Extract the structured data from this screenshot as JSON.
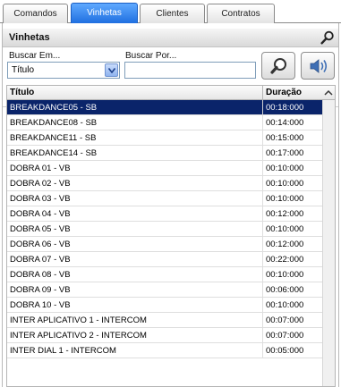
{
  "tabs": [
    {
      "label": "Comandos",
      "active": false
    },
    {
      "label": "Vinhetas",
      "active": true
    },
    {
      "label": "Clientes",
      "active": false
    },
    {
      "label": "Contratos",
      "active": false
    }
  ],
  "panel": {
    "title": "Vinhetas",
    "title_icon": "magnifier-icon"
  },
  "search": {
    "field_label": "Buscar Em...",
    "field_value": "Título",
    "query_label": "Buscar Por...",
    "query_value": "",
    "search_button_icon": "magnifier-icon",
    "audio_button_icon": "speaker-icon"
  },
  "table": {
    "columns": [
      "Título",
      "Duração"
    ],
    "selected_index": 0,
    "rows": [
      {
        "title": "BREAKDANCE05 - SB",
        "duration": "00:18:000"
      },
      {
        "title": "BREAKDANCE08 - SB",
        "duration": "00:14:000"
      },
      {
        "title": "BREAKDANCE11 - SB",
        "duration": "00:15:000"
      },
      {
        "title": "BREAKDANCE14 - SB",
        "duration": "00:17:000"
      },
      {
        "title": "DOBRA 01 - VB",
        "duration": "00:10:000"
      },
      {
        "title": "DOBRA 02 - VB",
        "duration": "00:10:000"
      },
      {
        "title": "DOBRA 03 - VB",
        "duration": "00:10:000"
      },
      {
        "title": "DOBRA 04 - VB",
        "duration": "00:12:000"
      },
      {
        "title": "DOBRA 05 - VB",
        "duration": "00:10:000"
      },
      {
        "title": "DOBRA 06 - VB",
        "duration": "00:12:000"
      },
      {
        "title": "DOBRA 07 - VB",
        "duration": "00:22:000"
      },
      {
        "title": "DOBRA 08 - VB",
        "duration": "00:10:000"
      },
      {
        "title": "DOBRA 09 - VB",
        "duration": "00:06:000"
      },
      {
        "title": "DOBRA 10 - VB",
        "duration": "00:10:000"
      },
      {
        "title": "INTER APLICATIVO 1 - INTERCOM",
        "duration": "00:07:000"
      },
      {
        "title": "INTER APLICATIVO 2 - INTERCOM",
        "duration": "00:07:000"
      },
      {
        "title": "INTER DIAL 1 - INTERCOM",
        "duration": "00:05:000"
      }
    ]
  },
  "colors": {
    "tab_active": "#1f6fe0",
    "selection": "#0a246a",
    "border": "#8a8a8a"
  }
}
